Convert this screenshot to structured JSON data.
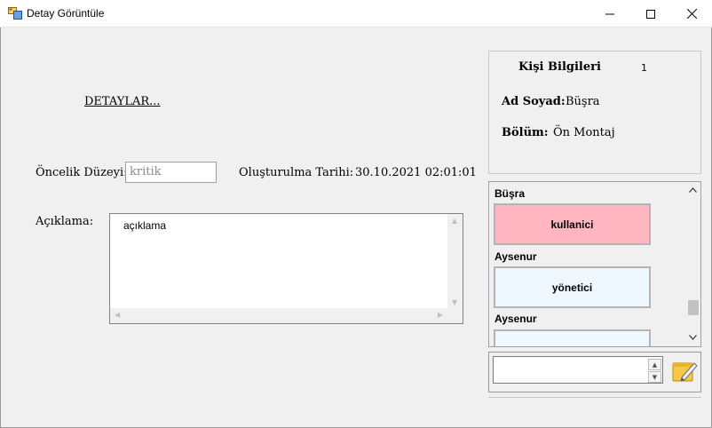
{
  "window": {
    "title": "Detay Görüntüle"
  },
  "details": {
    "link_label": "DETAYLAR..."
  },
  "priority": {
    "label": "Öncelik Düzeyi:",
    "value": "kritik"
  },
  "created": {
    "label": "Oluşturulma Tarihi:",
    "value": "30.10.2021 02:01:01"
  },
  "description": {
    "label": "Açıklama:",
    "value": "açıklama"
  },
  "person_info": {
    "title": "Kişi Bilgileri",
    "count": "1",
    "name_label": "Ad Soyad:",
    "name_value": "Büşra",
    "dept_label": "Bölüm:",
    "dept_value": "Ön Montaj"
  },
  "users": [
    {
      "name": "Büşra",
      "role": "kullanici",
      "color": "#ffb6c1"
    },
    {
      "name": "Aysenur",
      "role": "yönetici",
      "color": "#f0f8ff"
    },
    {
      "name": "Aysenur",
      "role": "",
      "color": "#f0f8ff"
    }
  ],
  "icons": {
    "app": "form-icon",
    "minimize": "minimize-icon",
    "maximize": "maximize-icon",
    "close": "close-icon",
    "send": "note-pencil-icon"
  }
}
